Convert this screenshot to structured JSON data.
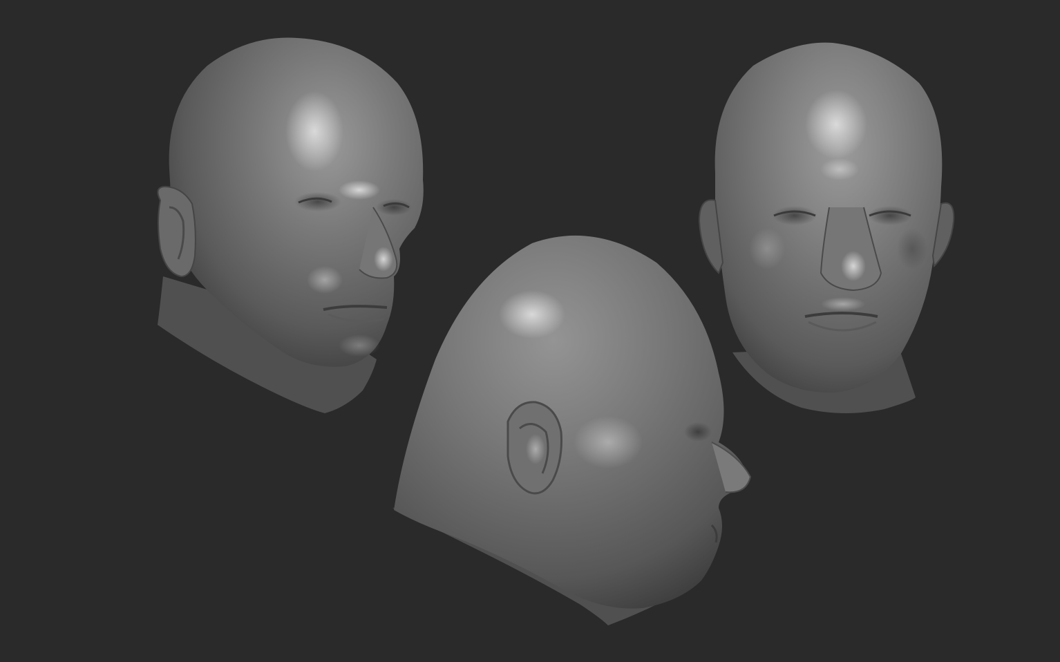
{
  "canvas": {
    "background": "#2a2a2a",
    "material_color": "#6e6e6e",
    "shadow_color": "#3a3a3a",
    "highlight_color": "#c8c8c8"
  },
  "models": [
    {
      "view": "three-quarter-right",
      "icon": "sculpted-head-icon"
    },
    {
      "view": "rear-three-quarter-left",
      "icon": "sculpted-head-icon"
    },
    {
      "view": "front",
      "icon": "sculpted-head-icon"
    }
  ]
}
